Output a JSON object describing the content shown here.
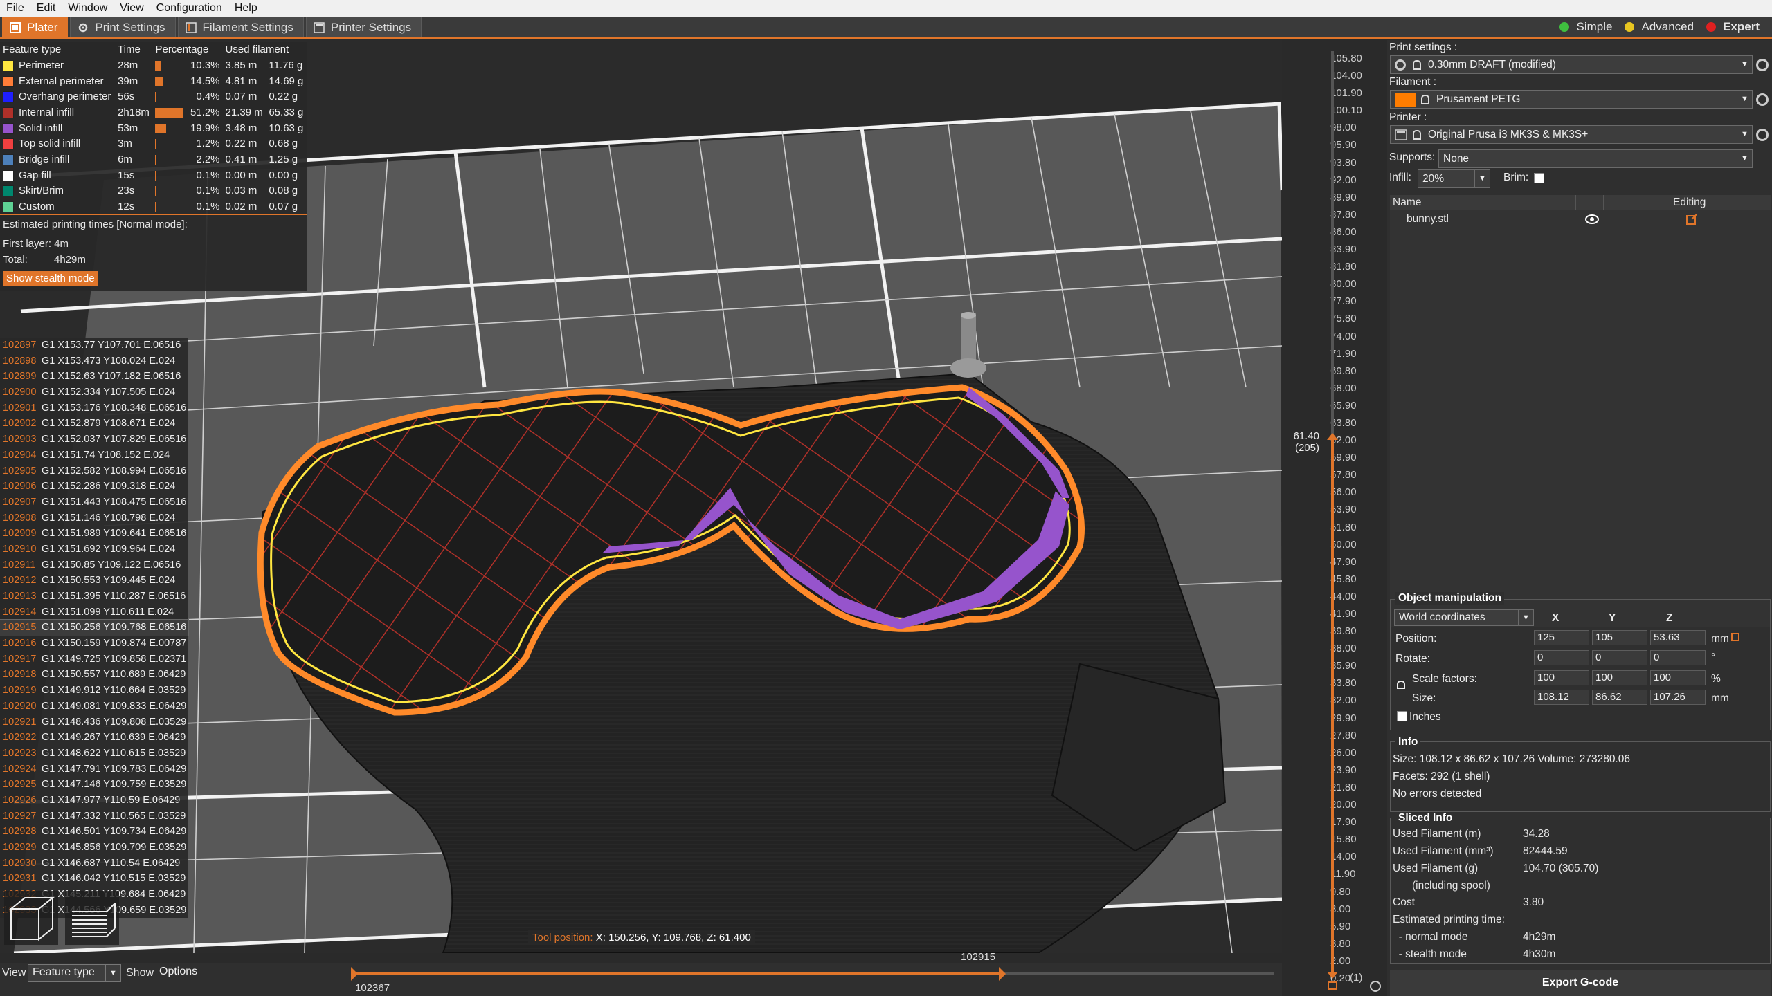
{
  "menu": [
    "File",
    "Edit",
    "Window",
    "View",
    "Configuration",
    "Help"
  ],
  "tabs": [
    "Plater",
    "Print Settings",
    "Filament Settings",
    "Printer Settings"
  ],
  "modes": [
    {
      "label": "Simple",
      "color": "#3fbf3f"
    },
    {
      "label": "Advanced",
      "color": "#e8c620"
    },
    {
      "label": "Expert",
      "color": "#e02020"
    }
  ],
  "legend": {
    "headers": [
      "Feature type",
      "Time",
      "Percentage",
      "Used filament"
    ],
    "rows": [
      {
        "name": "Perimeter",
        "color": "#ffe640",
        "time": "28m",
        "pct": "10.3%",
        "bar": 0.103,
        "m": "3.85 m",
        "g": "11.76 g"
      },
      {
        "name": "External perimeter",
        "color": "#ff7d38",
        "time": "39m",
        "pct": "14.5%",
        "bar": 0.145,
        "m": "4.81 m",
        "g": "14.69 g"
      },
      {
        "name": "Overhang perimeter",
        "color": "#1f1fff",
        "time": "56s",
        "pct": "0.4%",
        "bar": 0.004,
        "m": "0.07 m",
        "g": "0.22 g"
      },
      {
        "name": "Internal infill",
        "color": "#b03029",
        "time": "2h18m",
        "pct": "51.2%",
        "bar": 0.512,
        "m": "21.39 m",
        "g": "65.33 g"
      },
      {
        "name": "Solid infill",
        "color": "#9654cc",
        "time": "53m",
        "pct": "19.9%",
        "bar": 0.199,
        "m": "3.48 m",
        "g": "10.63 g"
      },
      {
        "name": "Top solid infill",
        "color": "#f04040",
        "time": "3m",
        "pct": "1.2%",
        "bar": 0.012,
        "m": "0.22 m",
        "g": "0.68 g"
      },
      {
        "name": "Bridge infill",
        "color": "#4d80ba",
        "time": "6m",
        "pct": "2.2%",
        "bar": 0.022,
        "m": "0.41 m",
        "g": "1.25 g"
      },
      {
        "name": "Gap fill",
        "color": "#ffffff",
        "time": "15s",
        "pct": "0.1%",
        "bar": 0.001,
        "m": "0.00 m",
        "g": "0.00 g"
      },
      {
        "name": "Skirt/Brim",
        "color": "#00876e",
        "time": "23s",
        "pct": "0.1%",
        "bar": 0.001,
        "m": "0.03 m",
        "g": "0.08 g"
      },
      {
        "name": "Custom",
        "color": "#5ed194",
        "time": "12s",
        "pct": "0.1%",
        "bar": 0.001,
        "m": "0.02 m",
        "g": "0.07 g"
      }
    ],
    "estimated_title": "Estimated printing times [Normal mode]:",
    "first_layer_label": "First layer:",
    "first_layer": "4m",
    "total_label": "Total:",
    "total": "4h29m",
    "stealth_button": "Show stealth mode"
  },
  "gcode": [
    {
      "n": "102897",
      "t": "G1 X153.77 Y107.701 E.06516"
    },
    {
      "n": "102898",
      "t": "G1 X153.473 Y108.024 E.024"
    },
    {
      "n": "102899",
      "t": "G1 X152.63 Y107.182 E.06516"
    },
    {
      "n": "102900",
      "t": "G1 X152.334 Y107.505 E.024"
    },
    {
      "n": "102901",
      "t": "G1 X153.176 Y108.348 E.06516"
    },
    {
      "n": "102902",
      "t": "G1 X152.879 Y108.671 E.024"
    },
    {
      "n": "102903",
      "t": "G1 X152.037 Y107.829 E.06516"
    },
    {
      "n": "102904",
      "t": "G1 X151.74 Y108.152 E.024"
    },
    {
      "n": "102905",
      "t": "G1 X152.582 Y108.994 E.06516"
    },
    {
      "n": "102906",
      "t": "G1 X152.286 Y109.318 E.024"
    },
    {
      "n": "102907",
      "t": "G1 X151.443 Y108.475 E.06516"
    },
    {
      "n": "102908",
      "t": "G1 X151.146 Y108.798 E.024"
    },
    {
      "n": "102909",
      "t": "G1 X151.989 Y109.641 E.06516"
    },
    {
      "n": "102910",
      "t": "G1 X151.692 Y109.964 E.024"
    },
    {
      "n": "102911",
      "t": "G1 X150.85 Y109.122 E.06516"
    },
    {
      "n": "102912",
      "t": "G1 X150.553 Y109.445 E.024"
    },
    {
      "n": "102913",
      "t": "G1 X151.395 Y110.287 E.06516"
    },
    {
      "n": "102914",
      "t": "G1 X151.099 Y110.611 E.024"
    },
    {
      "n": "102915",
      "t": "G1 X150.256 Y109.768 E.06516"
    },
    {
      "n": "102916",
      "t": "G1 X150.159 Y109.874 E.00787"
    },
    {
      "n": "102917",
      "t": "G1 X149.725 Y109.858 E.02371"
    },
    {
      "n": "102918",
      "t": "G1 X150.557 Y110.689 E.06429"
    },
    {
      "n": "102919",
      "t": "G1 X149.912 Y110.664 E.03529"
    },
    {
      "n": "102920",
      "t": "G1 X149.081 Y109.833 E.06429"
    },
    {
      "n": "102921",
      "t": "G1 X148.436 Y109.808 E.03529"
    },
    {
      "n": "102922",
      "t": "G1 X149.267 Y110.639 E.06429"
    },
    {
      "n": "102923",
      "t": "G1 X148.622 Y110.615 E.03529"
    },
    {
      "n": "102924",
      "t": "G1 X147.791 Y109.783 E.06429"
    },
    {
      "n": "102925",
      "t": "G1 X147.146 Y109.759 E.03529"
    },
    {
      "n": "102926",
      "t": "G1 X147.977 Y110.59 E.06429"
    },
    {
      "n": "102927",
      "t": "G1 X147.332 Y110.565 E.03529"
    },
    {
      "n": "102928",
      "t": "G1 X146.501 Y109.734 E.06429"
    },
    {
      "n": "102929",
      "t": "G1 X145.856 Y109.709 E.03529"
    },
    {
      "n": "102930",
      "t": "G1 X146.687 Y110.54 E.06429"
    },
    {
      "n": "102931",
      "t": "G1 X146.042 Y110.515 E.03529"
    },
    {
      "n": "102932",
      "t": "G1 X145.211 Y109.684 E.06429"
    },
    {
      "n": "102933",
      "t": "G1 X144.566 Y109.659 E.03529"
    }
  ],
  "tool_position": {
    "label": "Tool position:",
    "value": "X: 150.256, Y: 109.768, Z: 61.400"
  },
  "vslider": {
    "ticks": [
      "105.80",
      "104.00",
      "101.90",
      "100.10",
      "98.00",
      "95.90",
      "93.80",
      "92.00",
      "89.90",
      "87.80",
      "86.00",
      "83.90",
      "81.80",
      "80.00",
      "77.90",
      "75.80",
      "74.00",
      "71.90",
      "69.80",
      "68.00",
      "65.90",
      "63.80",
      "62.00",
      "59.90",
      "57.80",
      "56.00",
      "53.90",
      "51.80",
      "50.00",
      "47.90",
      "45.80",
      "44.00",
      "41.90",
      "39.80",
      "38.00",
      "35.90",
      "33.80",
      "32.00",
      "29.90",
      "27.80",
      "26.00",
      "23.90",
      "21.80",
      "20.00",
      "17.90",
      "15.80",
      "14.00",
      "11.90",
      "9.80",
      "8.00",
      "5.90",
      "3.80",
      "2.00",
      "0.20"
    ],
    "current_z": "61.40",
    "current_layer": "(205)",
    "bottom_layer": "(1)"
  },
  "bottombar": {
    "view_label": "View",
    "view_value": "Feature type",
    "show_label": "Show",
    "options": "Options",
    "h_start": "102367",
    "h_current": "102915"
  },
  "right": {
    "print_settings_label": "Print settings :",
    "print_settings": "0.30mm DRAFT (modified)",
    "filament_label": "Filament :",
    "filament": "Prusament PETG",
    "filament_color": "#ff7d00",
    "printer_label": "Printer :",
    "printer": "Original Prusa i3 MK3S & MK3S+",
    "supports_label": "Supports:",
    "supports": "None",
    "infill_label": "Infill:",
    "infill": "20%",
    "brim_label": "Brim:",
    "list_name": "Name",
    "list_editing": "Editing",
    "object": "bunny.stl",
    "om_title": "Object manipulation",
    "coords": "World coordinates",
    "axes": [
      "X",
      "Y",
      "Z"
    ],
    "position_label": "Position:",
    "position": [
      "125",
      "105",
      "53.63"
    ],
    "position_unit": "mm",
    "rotate_label": "Rotate:",
    "rotate": [
      "0",
      "0",
      "0"
    ],
    "rotate_unit": "°",
    "scale_label": "Scale factors:",
    "scale": [
      "100",
      "100",
      "100"
    ],
    "scale_unit": "%",
    "size_label": "Size:",
    "size": [
      "108.12",
      "86.62",
      "107.26"
    ],
    "size_unit": "mm",
    "inches": "Inches",
    "info_title": "Info",
    "info_size": "Size:   108.12 x 86.62 x 107.26  Volume:   273280.06",
    "info_facets": "Facets:   292 (1 shell)",
    "info_errors": "No errors detected",
    "sliced_title": "Sliced Info",
    "sliced": [
      {
        "k": "Used Filament (m)",
        "v": "34.28"
      },
      {
        "k": "Used Filament (mm³)",
        "v": "82444.59"
      },
      {
        "k": "Used Filament (g)",
        "v": "104.70 (305.70)"
      },
      {
        "k": "(including spool)",
        "v": ""
      },
      {
        "k": "Cost",
        "v": "3.80"
      },
      {
        "k": "Estimated printing time:",
        "v": ""
      },
      {
        "k": "  - normal mode",
        "v": "4h29m"
      },
      {
        "k": "  - stealth mode",
        "v": "4h30m"
      }
    ],
    "export": "Export G-code"
  }
}
